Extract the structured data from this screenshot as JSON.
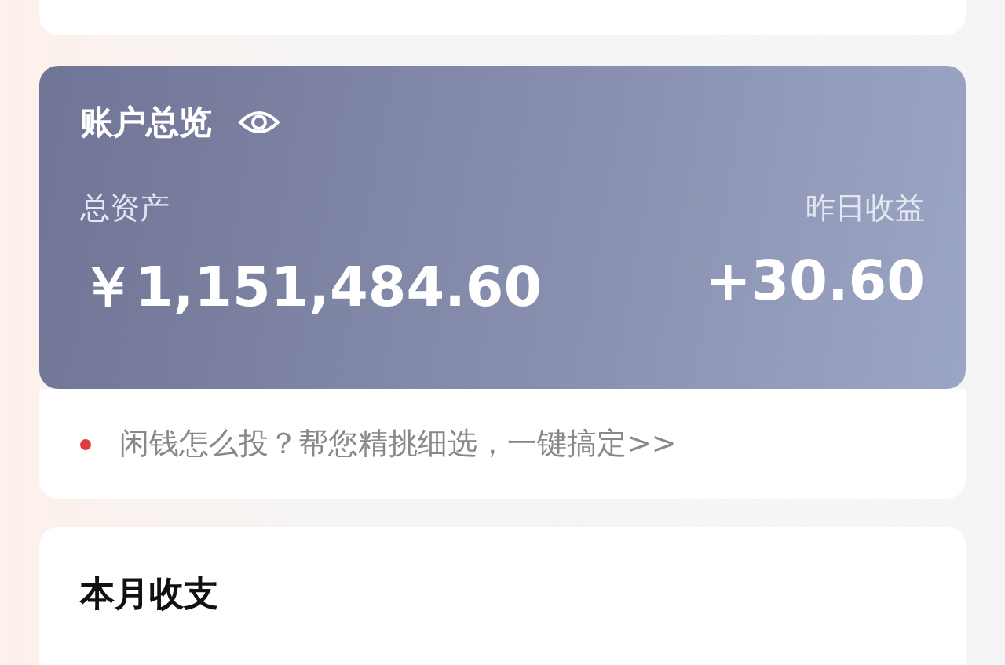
{
  "account": {
    "title": "账户总览",
    "total_label": "总资产",
    "total_value": "￥1,151,484.60",
    "yesterday_label": "昨日收益",
    "yesterday_value": "+30.60"
  },
  "tip": {
    "text": "闲钱怎么投？帮您精挑细选，一键搞定>>",
    "color": "#e0393e"
  },
  "monthly": {
    "title": "本月收支"
  }
}
